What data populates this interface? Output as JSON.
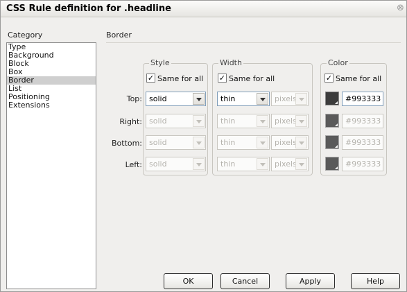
{
  "window": {
    "title": "CSS Rule definition for .headline"
  },
  "category": {
    "label": "Category",
    "items": [
      "Type",
      "Background",
      "Block",
      "Box",
      "Border",
      "List",
      "Positioning",
      "Extensions"
    ],
    "selected": "Border"
  },
  "panel": {
    "title": "Border"
  },
  "groups": {
    "style": {
      "legend": "Style",
      "same_for_all": "Same for all"
    },
    "width": {
      "legend": "Width",
      "same_for_all": "Same for all"
    },
    "color": {
      "legend": "Color",
      "same_for_all": "Same for all"
    }
  },
  "rows": {
    "top": {
      "label": "Top:",
      "style": "solid",
      "width": "thin",
      "unit": "pixels",
      "color": "#993333"
    },
    "right": {
      "label": "Right:",
      "style": "solid",
      "width": "thin",
      "unit": "pixels",
      "color": "#993333"
    },
    "bottom": {
      "label": "Bottom:",
      "style": "solid",
      "width": "thin",
      "unit": "pixels",
      "color": "#993333"
    },
    "left": {
      "label": "Left:",
      "style": "solid",
      "width": "thin",
      "unit": "pixels",
      "color": "#993333"
    }
  },
  "buttons": {
    "ok": "OK",
    "cancel": "Cancel",
    "apply": "Apply",
    "help": "Help"
  },
  "colors": {
    "selection_bg": "#cfcfcf",
    "dialog_bg": "#f0efed",
    "swatch": "#3c3c3c"
  }
}
